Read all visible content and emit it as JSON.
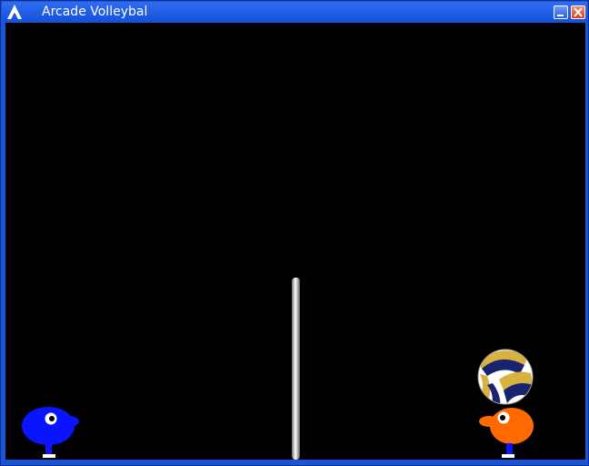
{
  "window": {
    "title": "Arcade Volleybal",
    "icon": "arcade-logo-icon"
  },
  "titlebar_buttons": [
    {
      "name": "minimize-button",
      "icon": "minimize-icon"
    },
    {
      "name": "close-button",
      "icon": "close-icon"
    }
  ],
  "game": {
    "background_color": "#000000",
    "players": [
      {
        "side": "left",
        "color": "#0a14ff"
      },
      {
        "side": "right",
        "color": "#ff6a00"
      }
    ],
    "ball": {
      "colors": [
        "#1a2370",
        "#d7b23c",
        "#ffffff"
      ]
    },
    "net": {
      "color": "#c8c8c8"
    }
  }
}
